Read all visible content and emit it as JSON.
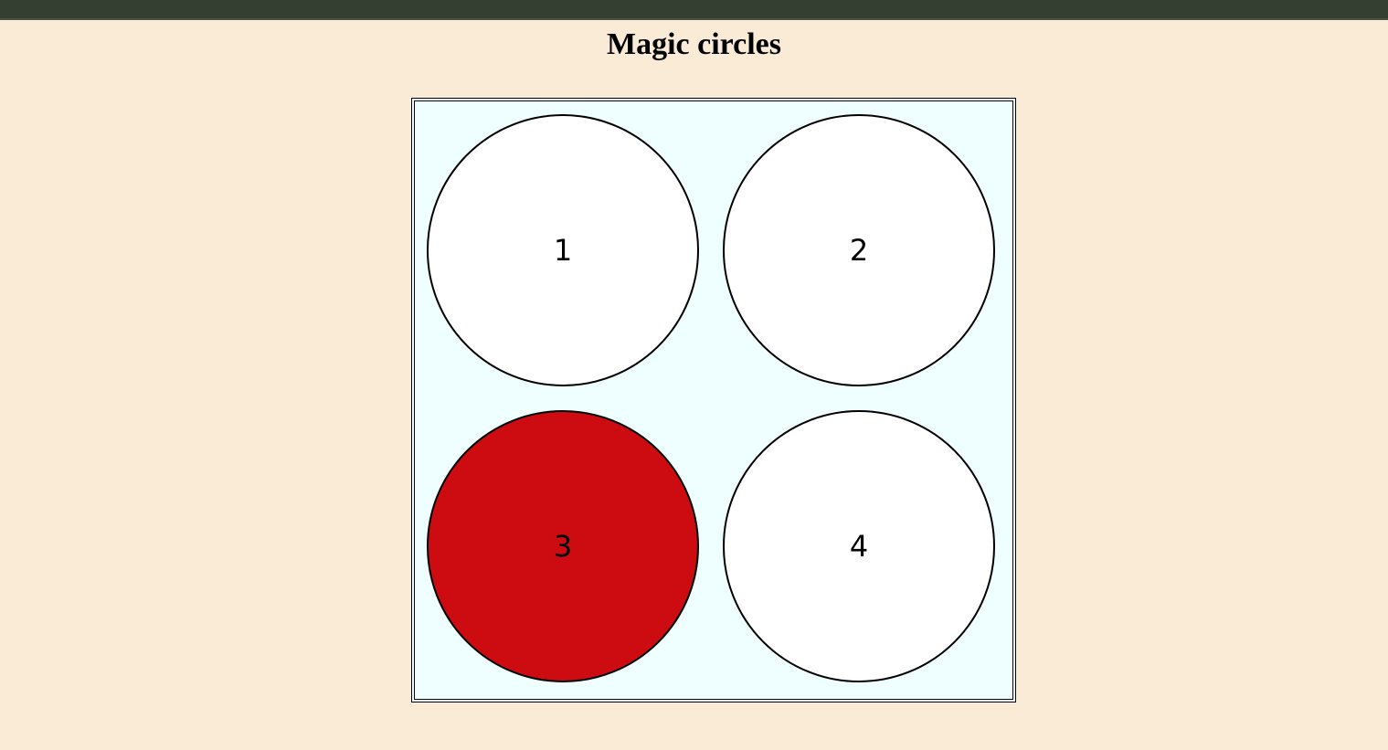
{
  "page": {
    "title": "Magic circles"
  },
  "colors": {
    "top_bar": "#343f31",
    "background": "#faebd7",
    "board_background": "#effefe",
    "circle_default": "#ffffff",
    "circle_active": "#cd0c12"
  },
  "board": {
    "circles": [
      {
        "label": "1",
        "active": false
      },
      {
        "label": "2",
        "active": false
      },
      {
        "label": "3",
        "active": true
      },
      {
        "label": "4",
        "active": false
      }
    ]
  }
}
